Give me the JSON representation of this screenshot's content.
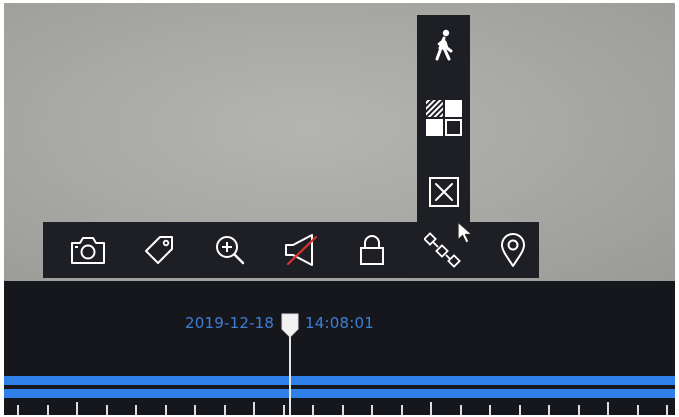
{
  "playback": {
    "timestamp_date": "2019-12-18",
    "timestamp_time": "14:08:01"
  },
  "toolbar": {
    "items": [
      {
        "name": "snapshot",
        "icon": "camera-icon"
      },
      {
        "name": "tag",
        "icon": "tag-icon"
      },
      {
        "name": "digital-zoom",
        "icon": "zoom-in-icon"
      },
      {
        "name": "audio",
        "icon": "speaker-muted-icon"
      },
      {
        "name": "lock",
        "icon": "lock-icon"
      },
      {
        "name": "smart",
        "icon": "nodes-icon"
      },
      {
        "name": "location",
        "icon": "location-pin-icon"
      }
    ]
  },
  "smart_panel": {
    "items": [
      {
        "name": "motion-detection",
        "icon": "walking-person-icon"
      },
      {
        "name": "area-grid",
        "icon": "grid-area-icon"
      },
      {
        "name": "clear",
        "icon": "close-box-icon"
      }
    ]
  },
  "colors": {
    "accent": "#2f80e8",
    "timestamp": "#3e7fd6",
    "panel": "#1e1f24",
    "timeline_bg": "#16171d",
    "mute_slash": "#d8322c"
  }
}
